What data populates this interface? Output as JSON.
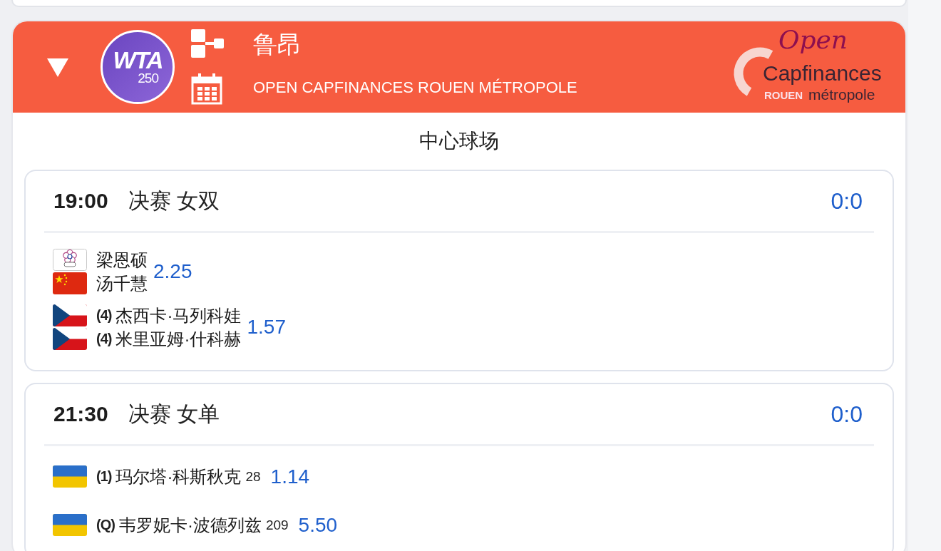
{
  "tournament": {
    "expanded": true,
    "badge": {
      "text": "WTA",
      "tier": "250"
    },
    "name": "鲁昂",
    "full_name": "OPEN CAPFINANCES ROUEN MÉTROPOLE",
    "sponsor_logo": {
      "script": "Open",
      "brand": "Capfinances",
      "city": "ROUEN",
      "tagline": "métropole"
    }
  },
  "court": "中心球场",
  "matches": [
    {
      "time": "19:00",
      "round": "决赛 女双",
      "score": "0:0",
      "teams": [
        {
          "odds": "2.25",
          "players": [
            {
              "kind": "tpe",
              "name": "梁恩硕"
            },
            {
              "kind": "chn",
              "name": "汤千慧"
            }
          ]
        },
        {
          "odds": "1.57",
          "players": [
            {
              "kind": "cze",
              "seed": "(4)",
              "name": "杰西卡·马列科娃"
            },
            {
              "kind": "cze",
              "seed": "(4)",
              "name": "米里亚姆·什科赫"
            }
          ]
        }
      ]
    },
    {
      "time": "21:30",
      "round": "决赛 女单",
      "score": "0:0",
      "teams": [
        {
          "odds": "1.14",
          "players": [
            {
              "kind": "ukr",
              "seed": "(1)",
              "name": "玛尔塔·科斯秋克",
              "rank": "28"
            }
          ]
        },
        {
          "odds": "5.50",
          "players": [
            {
              "kind": "ukr",
              "seed": "(Q)",
              "name": "韦罗妮卡·波德列兹",
              "rank": "209"
            }
          ]
        }
      ]
    }
  ]
}
